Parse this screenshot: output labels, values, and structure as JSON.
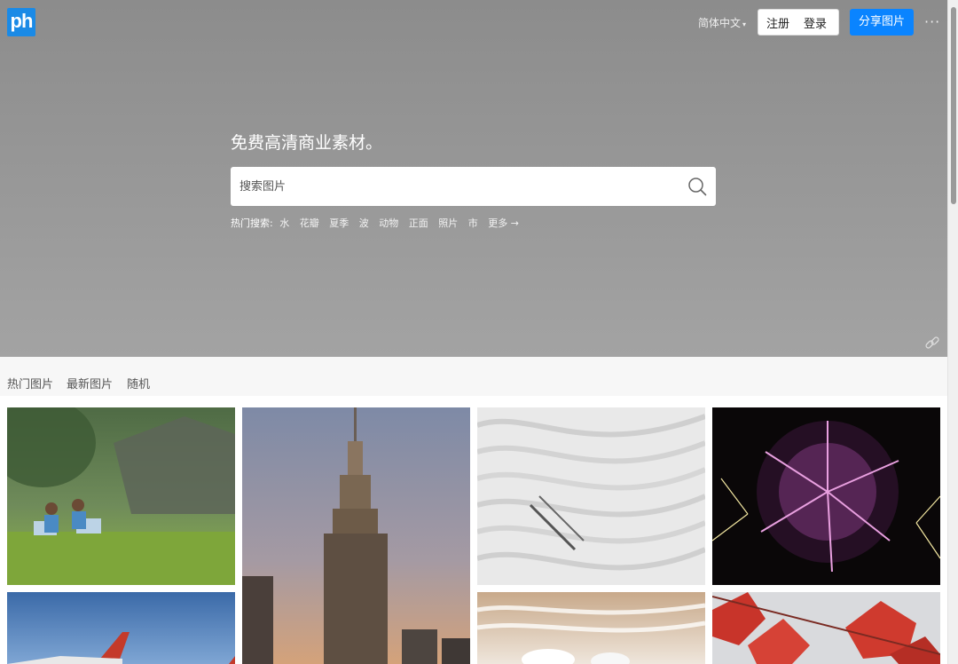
{
  "header": {
    "logo_text": "ph",
    "language": "简体中文",
    "register": "注册",
    "login": "登录",
    "share": "分享图片",
    "more": "···"
  },
  "hero": {
    "tagline": "免费高清商业素材。",
    "search_placeholder": "搜索图片",
    "hot_label": "热门搜索:",
    "hot_tags": [
      "水",
      "花瓣",
      "夏季",
      "波",
      "动物",
      "正面",
      "照片",
      "市",
      "更多 →"
    ]
  },
  "tabs": [
    "热门图片",
    "最新图片",
    "随机"
  ],
  "colors": {
    "accent": "#0a84ff",
    "logo": "#1a8ae6"
  },
  "icons": [
    "search-icon",
    "link-icon",
    "caret-down-icon",
    "more-icon"
  ],
  "gallery": [
    "children-with-laptops-photo",
    "empire-state-building-photo",
    "white-architecture-waves-photo",
    "fireworks-photo",
    "jet-plane-photo",
    "white-flowers-water-photo",
    "red-maple-leaves-photo"
  ]
}
